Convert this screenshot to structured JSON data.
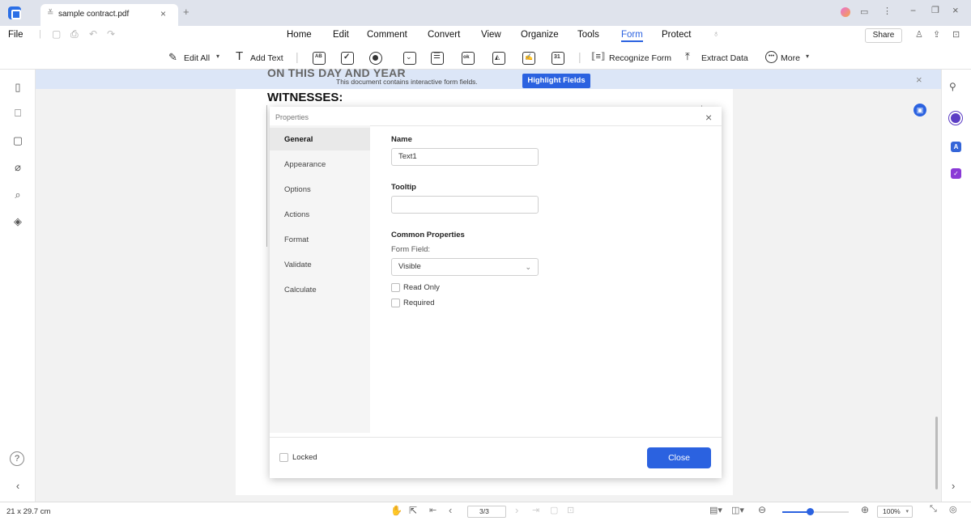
{
  "tab": {
    "title": "sample contract.pdf"
  },
  "menu": {
    "file": "File",
    "items": [
      "Home",
      "Edit",
      "Comment",
      "Convert",
      "View",
      "Organize",
      "Tools",
      "Form",
      "Protect"
    ],
    "active": "Form",
    "share": "Share"
  },
  "toolbar": {
    "edit_all": "Edit All",
    "add_text": "Add Text",
    "recognize_form": "Recognize Form",
    "extract_data": "Extract Data",
    "more": "More"
  },
  "banner": {
    "message": "This document contains interactive form fields.",
    "button": "Highlight Fields"
  },
  "document": {
    "heading1": "ON THIS DAY AND YEAR",
    "heading2": "WITNESSES:"
  },
  "dialog": {
    "title": "Properties",
    "nav": [
      "General",
      "Appearance",
      "Options",
      "Actions",
      "Format",
      "Validate",
      "Calculate"
    ],
    "active_nav": "General",
    "name_label": "Name",
    "name_value": "Text1",
    "tooltip_label": "Tooltip",
    "tooltip_value": "",
    "common_label": "Common Properties",
    "form_field_label": "Form Field:",
    "form_field_value": "Visible",
    "read_only": "Read Only",
    "required": "Required",
    "locked": "Locked",
    "close": "Close"
  },
  "status": {
    "page_size": "21 x 29.7 cm",
    "page_indicator": "3/3",
    "zoom": "100%"
  },
  "colors": {
    "accent": "#2b62e0",
    "banner": "#dce6f7"
  }
}
